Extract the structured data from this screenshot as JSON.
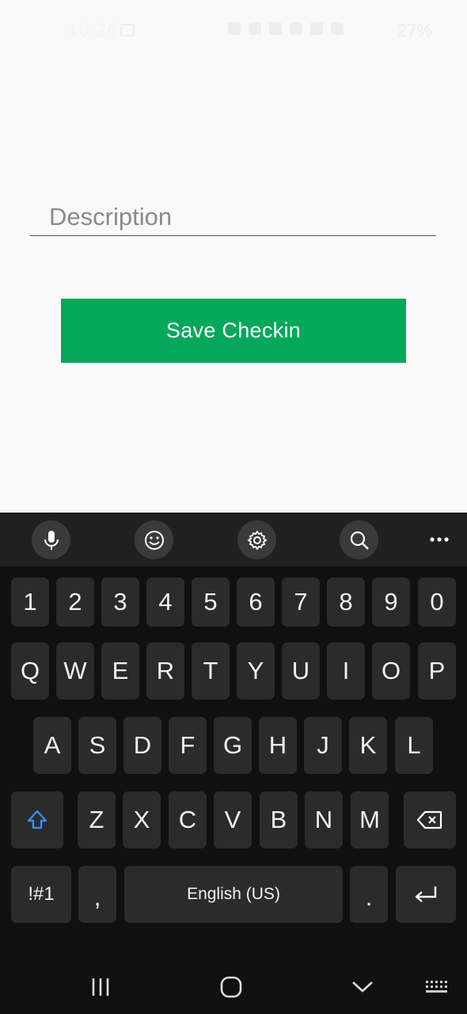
{
  "status_bar": {
    "time": "10:26",
    "battery": "27%"
  },
  "form": {
    "description_placeholder": "Description",
    "description_value": "",
    "save_label": "Save Checkin"
  },
  "keyboard": {
    "toolbar_icons": [
      "microphone-icon",
      "emoji-icon",
      "settings-icon",
      "search-icon",
      "more-icon"
    ],
    "number_row": [
      "1",
      "2",
      "3",
      "4",
      "5",
      "6",
      "7",
      "8",
      "9",
      "0"
    ],
    "row1": [
      "Q",
      "W",
      "E",
      "R",
      "T",
      "Y",
      "U",
      "I",
      "O",
      "P"
    ],
    "row2": [
      "A",
      "S",
      "D",
      "F",
      "G",
      "H",
      "J",
      "K",
      "L"
    ],
    "row3": [
      "Z",
      "X",
      "C",
      "V",
      "B",
      "N",
      "M"
    ],
    "symbols_label": "!#1",
    "comma": ",",
    "space_label": "English (US)",
    "period": ".",
    "shift_color": "#3d8bf0"
  },
  "colors": {
    "accent": "#05a85a",
    "keyboard_bg": "#101010",
    "key_bg": "#2b2b2b"
  }
}
